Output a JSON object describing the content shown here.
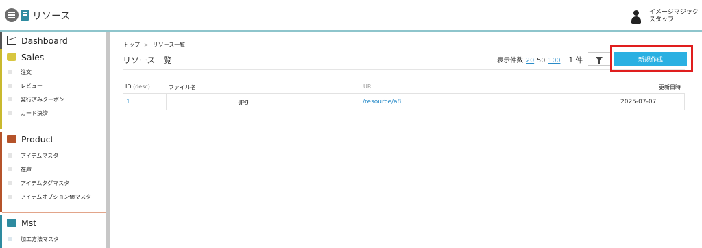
{
  "header": {
    "app_title": "リソース",
    "user_name_line1": "イメージマジック",
    "user_name_line2": "スタッフ"
  },
  "sidebar": {
    "sections": [
      {
        "title": "Dashboard",
        "icon": "chart-icon",
        "color": "#555555",
        "items": []
      },
      {
        "title": "Sales",
        "icon": "coins-icon",
        "color": "#c9b92e",
        "items": [
          "注文",
          "レビュー",
          "発行済みクーポン",
          "カード決済"
        ]
      },
      {
        "title": "Product",
        "icon": "boxes-icon",
        "color": "#b5532a",
        "items": [
          "アイテムマスタ",
          "在庫",
          "アイテムタグマスタ",
          "アイテムオプション値マスタ"
        ]
      },
      {
        "title": "Mst",
        "icon": "book-icon",
        "color": "#2e8ba0",
        "items": [
          "加工方法マスタ"
        ]
      }
    ]
  },
  "main": {
    "breadcrumb": [
      "トップ",
      "リソース一覧"
    ],
    "page_title": "リソース一覧",
    "count_label": "表示件数",
    "page_sizes": [
      "20",
      "50",
      "100"
    ],
    "total": "1 件",
    "new_button_label": "新規作成",
    "table": {
      "columns": {
        "id": "ID",
        "id_sort": "(desc)",
        "filename": "ファイル名",
        "url": "URL",
        "updated": "更新日時"
      },
      "rows": [
        {
          "id": "1",
          "filename": ".jpg",
          "url": "/resource/a8",
          "updated": "2025-07-07"
        }
      ]
    }
  },
  "colors": {
    "accent": "#2ab0e2",
    "highlight": "#e01e1e",
    "link": "#2a8cc9"
  }
}
